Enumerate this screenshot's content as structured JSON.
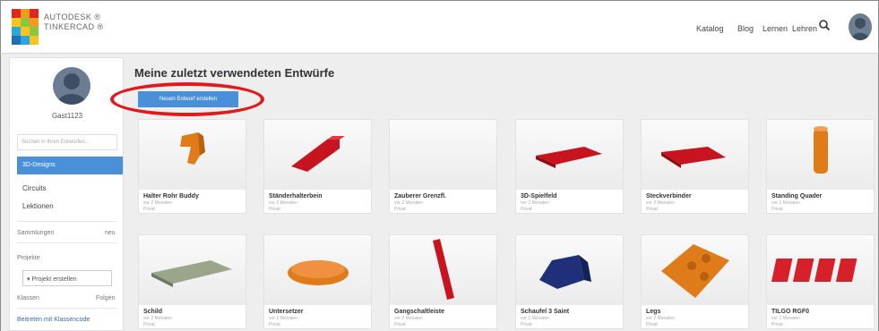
{
  "header": {
    "logo_line1": "AUTODESK ®",
    "logo_line2": "TINKERCAD ®",
    "nav": [
      "Katalog",
      "Blog",
      "Lernen",
      "Lehren"
    ],
    "search_icon": "search-icon",
    "avatar_icon": "user-avatar-icon"
  },
  "sidebar": {
    "username": "Gast1123",
    "search_placeholder": "Suchen in Ihren Entwürfen...",
    "active_item": "3D-Designs",
    "items": [
      "Circuits",
      "Lektionen"
    ],
    "collections_label": "Sammlungen",
    "collections_action": "neu",
    "projects_label": "Projekte",
    "project_select": "Projekt erstellen",
    "classes_label": "Klassen",
    "classes_action": "Folgen",
    "link": "Beitreten mit Klassencode"
  },
  "main": {
    "title": "Meine zuletzt verwendeten Entwürfe",
    "create_button": "Neuen Entwurf erstellen"
  },
  "designs": [
    {
      "name": "Halter Rohr Buddy",
      "meta1": "vor 2 Monaten",
      "meta2": "Privat",
      "color": "#e07b1a"
    },
    {
      "name": "Ständerhalterbein",
      "meta1": "vor 2 Monaten",
      "meta2": "Privat",
      "color": "#c8141e"
    },
    {
      "name": "Zauberer Grenzfl.",
      "meta1": "vor 2 Monaten",
      "meta2": "Privat",
      "color": "#eeeeee"
    },
    {
      "name": "3D-Spielfeld",
      "meta1": "vor 2 Monaten",
      "meta2": "Privat",
      "color": "#c8141e"
    },
    {
      "name": "Steckverbinder",
      "meta1": "vor 2 Monaten",
      "meta2": "Privat",
      "color": "#c8141e"
    },
    {
      "name": "Standing Quader",
      "meta1": "vor 2 Monaten",
      "meta2": "Privat",
      "color": "#e07b1a"
    },
    {
      "name": "Schild",
      "meta1": "vor 2 Monaten",
      "meta2": "Privat",
      "color": "#9aa58a"
    },
    {
      "name": "Untersetzer",
      "meta1": "vor 2 Monaten",
      "meta2": "Privat",
      "color": "#e07b1a"
    },
    {
      "name": "Gangschaltleiste",
      "meta1": "vor 2 Monaten",
      "meta2": "Privat",
      "color": "#c8141e"
    },
    {
      "name": "Schaufel 3 Saint",
      "meta1": "vor 2 Monaten",
      "meta2": "Privat",
      "color": "#1f2f7a"
    },
    {
      "name": "Legs",
      "meta1": "vor 2 Monaten",
      "meta2": "Privat",
      "color": "#e07b1a"
    },
    {
      "name": "TILGO RGF0",
      "meta1": "vor 2 Monaten",
      "meta2": "Privat",
      "color": "#d8202a"
    }
  ]
}
